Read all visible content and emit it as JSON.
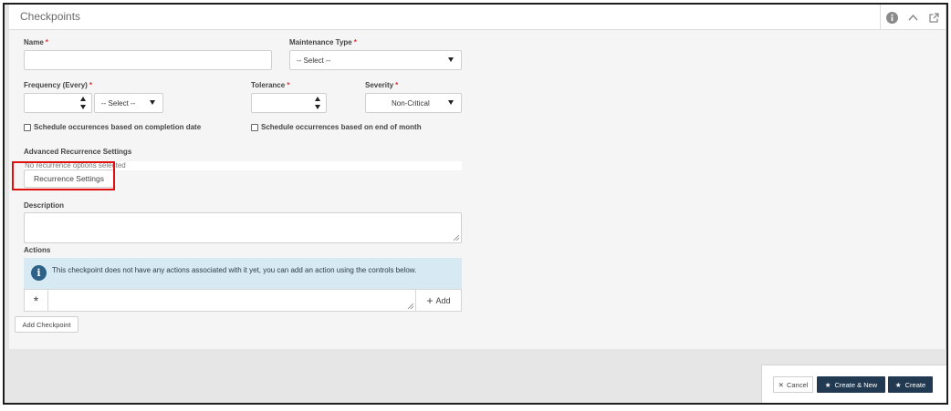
{
  "panel": {
    "title": "Checkpoints",
    "icons": [
      "info-icon",
      "chevron-up-icon",
      "external-link-icon"
    ]
  },
  "form": {
    "name_label": "Name",
    "required_mark": "*",
    "name_value": "",
    "maintenance_type_label": "Maintenance Type",
    "maintenance_type_value": "-- Select --",
    "frequency_label": "Frequency (Every)",
    "frequency_value": "",
    "frequency_unit_value": "-- Select --",
    "tolerance_label": "Tolerance",
    "tolerance_value": "",
    "severity_label": "Severity",
    "severity_value": "Non-Critical",
    "schedule_completion_label": "Schedule occurences based on completion date",
    "schedule_completion_checked": false,
    "schedule_month_end_label": "Schedule occurrences based on end of month",
    "schedule_month_end_checked": false,
    "advanced_recurrence_label": "Advanced Recurrence Settings",
    "no_recurrence_text": "No recurrence options selected",
    "recurrence_settings_button": "Recurrence Settings",
    "description_label": "Description",
    "description_value": "",
    "actions_label": "Actions",
    "actions_info": "This checkpoint does not have any actions associated with it yet, you can add an action using the controls below.",
    "action_asterisk": "*",
    "action_input_value": "",
    "add_button": "Add",
    "add_checkpoint_button": "Add Checkpoint"
  },
  "footer": {
    "cancel": "Cancel",
    "create_new": "Create & New",
    "create": "Create"
  },
  "colors": {
    "required": "#dd3333",
    "info_bg": "#d7e9f3",
    "primary_button": "#213a52",
    "highlight": "#e01010"
  }
}
